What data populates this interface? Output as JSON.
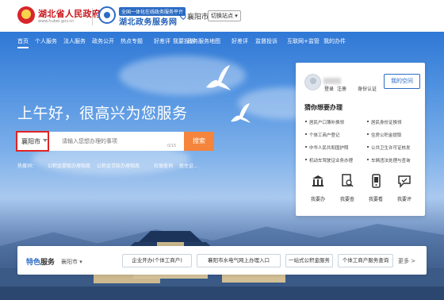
{
  "header": {
    "gov_name": "湖北省人民政府",
    "gov_url": "www.hubei.gov.cn",
    "portal_badge": "全国一体化在线政务服务平台",
    "portal_name": "湖北政务服务网",
    "location": "襄阳市",
    "switch_label": "切换站点 ▾"
  },
  "nav": {
    "items": [
      "首页",
      "个人服务",
      "法人服务",
      "政务公开",
      "热点专题",
      "好差评",
      "我要投诉",
      "政务服务地图",
      "好差评",
      "监督投诉",
      "互联网+监管",
      "我的办件"
    ]
  },
  "hero": {
    "greeting": "上午好，很高兴为您服务",
    "search": {
      "city": "襄阳市",
      "placeholder": "请输入您想办理的事项",
      "count": "0/15",
      "button": "搜索"
    },
    "hot": [
      "热搜词：",
      "公积金提取办理指南",
      "公积金贷款办理指南",
      "社保查询",
      "居住证..."
    ]
  },
  "panel": {
    "login": "登录",
    "register": "注册",
    "id_auth": "身份认证",
    "my_space": "我的空间",
    "rec_title": "猜你想要办理",
    "rec_items": [
      "居民户口簿补换领",
      "居民身份证换领",
      "个体工商户登记",
      "住房公积金提取",
      "中华人民共和国护照",
      "公共卫生许可证核发",
      "机动车驾驶证业务办理",
      "车辆违法处理与查询"
    ],
    "quick": [
      {
        "label": "我要办",
        "icon": "building-icon"
      },
      {
        "label": "我要查",
        "icon": "document-search-icon"
      },
      {
        "label": "我要看",
        "icon": "phone-icon"
      },
      {
        "label": "我要评",
        "icon": "chat-icon"
      }
    ]
  },
  "features": {
    "title_a": "特色",
    "title_b": "服务",
    "city": "襄阳市 ▾",
    "buttons": [
      "企业开办(个体工商户)",
      "襄阳市水电气网上办理入口",
      "一站式公积金服务",
      "个体工商户服务查询"
    ],
    "more": "更多 >"
  }
}
